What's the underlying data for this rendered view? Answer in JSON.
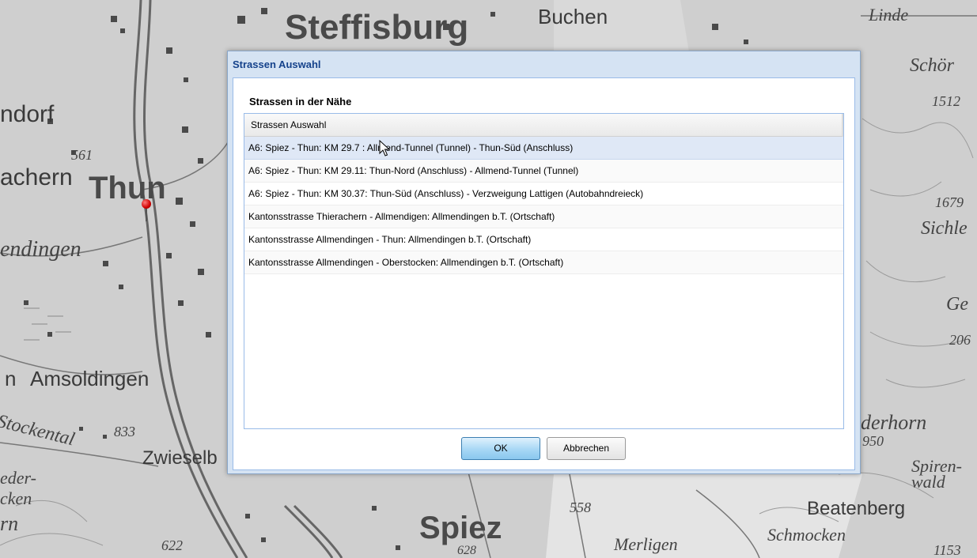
{
  "map": {
    "labels": {
      "stoffisburg": "Steffisburg",
      "buchen": "Buchen",
      "linde": "Linde",
      "schor": "Schör",
      "n1512": "1512",
      "dorf": "ndorf",
      "n561": "561",
      "achern": "achern",
      "thun": "Thun",
      "n1679": "1679",
      "sichle": "Sichle",
      "endingen": "endingen",
      "ge": "Ge",
      "n206": "206",
      "amsoldingen": "Amsoldingen",
      "n833": "833",
      "stockental": "Stockental",
      "zwieselb": "Zwieselb",
      "derhorn": "derhorn",
      "n950": "950",
      "spirenwald": "Spiren-wald",
      "spiez": "Spiez",
      "n558": "558",
      "beatenberg": "Beatenberg",
      "schmocken": "Schmocken",
      "merligen": "Merligen",
      "n622": "622",
      "n628": "628",
      "n1153": "1153",
      "eder": "eder-",
      "cken": "cken",
      "rn": "rn",
      "n": "n"
    }
  },
  "dialog": {
    "title": "Strassen Auswahl",
    "section_heading": "Strassen in der Nähe",
    "grid": {
      "column_header": "Strassen Auswahl",
      "rows": [
        "A6: Spiez - Thun: KM 29.7 : Allmend-Tunnel (Tunnel) - Thun-Süd (Anschluss)",
        "A6: Spiez - Thun: KM 29.11: Thun-Nord (Anschluss) - Allmend-Tunnel (Tunnel)",
        "A6: Spiez - Thun: KM 30.37: Thun-Süd (Anschluss) - Verzweigung Lattigen (Autobahndreieck)",
        "Kantonsstrasse Thierachern - Allmendigen: Allmendingen b.T. (Ortschaft)",
        "Kantonsstrasse Allmendingen - Thun: Allmendingen b.T. (Ortschaft)",
        "Kantonsstrasse Allmendingen - Oberstocken: Allmendingen b.T. (Ortschaft)"
      ],
      "selected_index": 0
    },
    "ok_label": "OK",
    "cancel_label": "Abbrechen"
  }
}
